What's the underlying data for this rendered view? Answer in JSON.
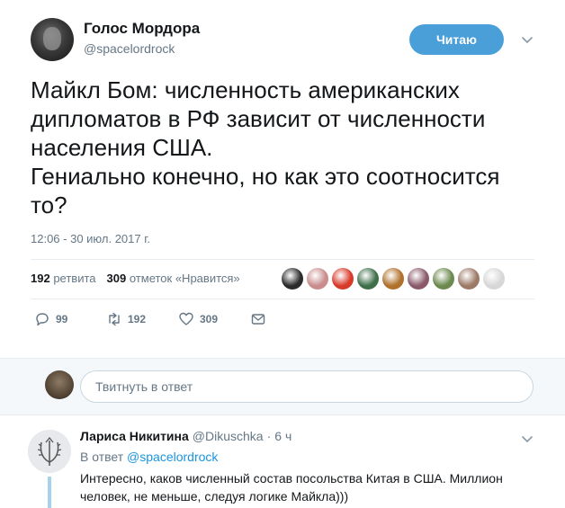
{
  "tweet": {
    "author_name": "Голос Мордора",
    "author_handle": "@spacelordrock",
    "follow_label": "Читаю",
    "text": "Майкл Бом: численность американских\nдипломатов в РФ зависит от численности\nнаселения США.\nГениально конечно, но как это соотносится\nто?",
    "timestamp": "12:06 - 30 июл. 2017 г.",
    "stats": {
      "retweets_count": "192",
      "retweets_label": "ретвита",
      "likes_count": "309",
      "likes_label": "отметок «Нравится»"
    },
    "likers": [
      "#2b2b2b",
      "#c98d8d",
      "#d83a2a",
      "#3f6f4a",
      "#b0712c",
      "#8a5a6b",
      "#6c8a4f",
      "#9d7a68",
      "#d7d7d7"
    ],
    "actions": {
      "replies": "99",
      "retweets": "192",
      "likes": "309"
    }
  },
  "reply_box": {
    "placeholder": "Твитнуть в ответ"
  },
  "reply": {
    "author_name": "Лариса Никитина",
    "author_handle": "@Dikuschka",
    "separator": "·",
    "time": "6 ч",
    "reply_to_label": "В ответ",
    "reply_to_handle": "@spacelordrock",
    "text": "Интересно, каков численный состав посольства Китая в США. Миллион человек, не меньше, следуя логике Майкла)))"
  },
  "colors": {
    "accent": "#1da1f2",
    "follow_button": "#4a9fd9",
    "muted": "#657786",
    "reply_bar": "#f5f8fa"
  }
}
